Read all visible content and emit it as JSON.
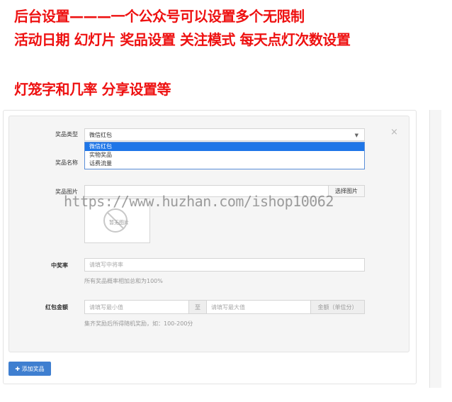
{
  "headlines": {
    "line1": "后台设置———一个公众号可以设置多个无限制",
    "line2": "活动日期 幻灯片 奖品设置 关注模式 每天点灯次数设置",
    "line3": "灯笼字和几率  分享设置等"
  },
  "form": {
    "close_symbol": "×",
    "prize_type": {
      "label": "奖品类型",
      "value": "微信红包",
      "chevron": "▼",
      "options": [
        "微信红包",
        "实物奖品",
        "话费流量"
      ],
      "selected_index": 0
    },
    "prize_name": {
      "label": "奖品名称"
    },
    "prize_image": {
      "label": "奖品图片",
      "select_button": "选择图片",
      "no_image_text": "暂无图片"
    },
    "win_rate": {
      "label": "中奖率",
      "placeholder": "请填写中将率",
      "hint": "所有奖品概率相加总和为100%"
    },
    "red_packet": {
      "label": "红包金额",
      "min_placeholder": "请填写最小值",
      "separator": "至",
      "max_placeholder": "请填写最大值",
      "unit": "金额（单位分）",
      "hint": "集齐奖励后所得随机奖励，如：100-200分"
    },
    "add_button": "✚ 添加奖品"
  },
  "watermark": "https://www.huzhan.com/ishop10062",
  "colors": {
    "headline": "#ee1111",
    "primary_button": "#3f7fd0",
    "selected_option": "#1e76e8"
  }
}
